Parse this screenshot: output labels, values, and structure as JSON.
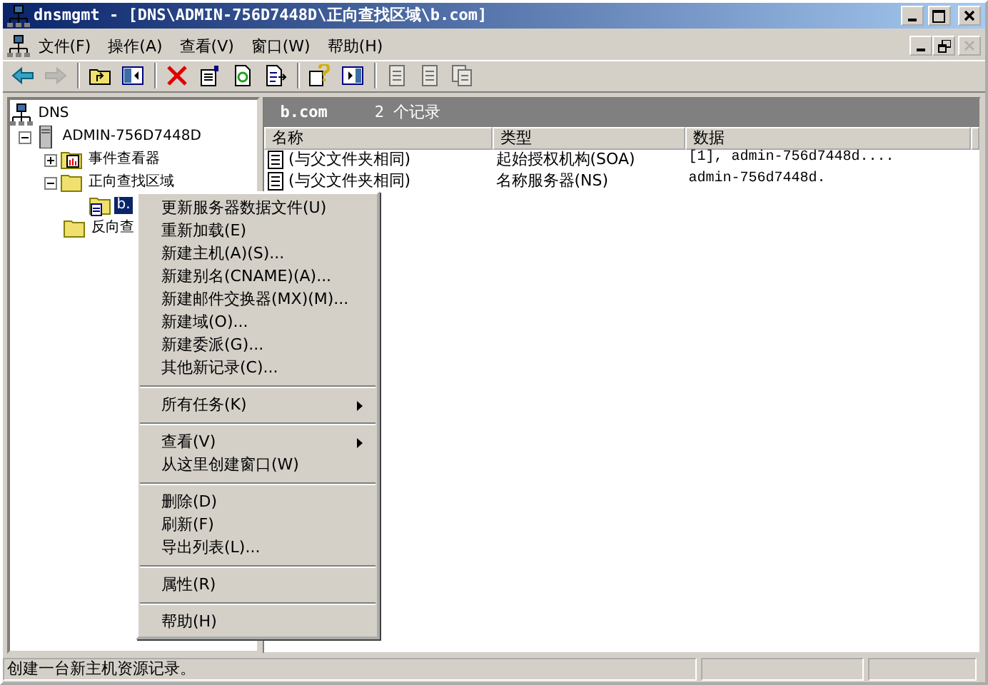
{
  "window": {
    "title": "dnsmgmt - [DNS\\ADMIN-756D7448D\\正向查找区域\\b.com]"
  },
  "menu_bar": [
    "文件(F)",
    "操作(A)",
    "查看(V)",
    "窗口(W)",
    "帮助(H)"
  ],
  "toolbar": [
    {
      "kind": "back",
      "disabled": false
    },
    {
      "kind": "forward",
      "disabled": true
    },
    {
      "kind": "separator"
    },
    {
      "kind": "up",
      "disabled": false
    },
    {
      "kind": "tree",
      "disabled": false
    },
    {
      "kind": "separator"
    },
    {
      "kind": "delete",
      "disabled": false
    },
    {
      "kind": "properties",
      "disabled": false
    },
    {
      "kind": "refresh",
      "disabled": false
    },
    {
      "kind": "export",
      "disabled": false
    },
    {
      "kind": "separator"
    },
    {
      "kind": "help",
      "disabled": false
    },
    {
      "kind": "panel",
      "disabled": false
    },
    {
      "kind": "separator"
    },
    {
      "kind": "doc",
      "disabled": true
    },
    {
      "kind": "doc",
      "disabled": true
    },
    {
      "kind": "docs",
      "disabled": true
    }
  ],
  "tree": [
    {
      "label": "DNS",
      "kind": "dns",
      "selected": false,
      "children": [
        {
          "label": "ADMIN-756D7448D",
          "kind": "server",
          "expanded": true,
          "selected": false,
          "children": [
            {
              "label": "事件查看器",
              "kind": "event",
              "expanded": false,
              "selected": false
            },
            {
              "label": "正向查找区域",
              "kind": "folder",
              "expanded": true,
              "selected": false,
              "children": [
                {
                  "label": "b.",
                  "kind": "zone",
                  "selected": true
                }
              ]
            },
            {
              "label": "反向查",
              "kind": "folder",
              "selected": false
            }
          ]
        }
      ]
    }
  ],
  "header": {
    "name": "b.com",
    "count": "2 个记录"
  },
  "columns": [
    "名称",
    "类型",
    "数据"
  ],
  "rows": [
    {
      "name": "(与父文件夹相同)",
      "type": "起始授权机构(SOA)",
      "data": "[1], admin-756d7448d...."
    },
    {
      "name": "(与父文件夹相同)",
      "type": "名称服务器(NS)",
      "data": "admin-756d7448d."
    }
  ],
  "context_menu": [
    {
      "kind": "item",
      "label": "更新服务器数据文件(U)",
      "submenu": false
    },
    {
      "kind": "item",
      "label": "重新加载(E)",
      "submenu": false
    },
    {
      "kind": "item",
      "label": "新建主机(A)(S)...",
      "submenu": false
    },
    {
      "kind": "item",
      "label": "新建别名(CNAME)(A)...",
      "submenu": false
    },
    {
      "kind": "item",
      "label": "新建邮件交换器(MX)(M)...",
      "submenu": false
    },
    {
      "kind": "item",
      "label": "新建域(O)...",
      "submenu": false
    },
    {
      "kind": "item",
      "label": "新建委派(G)...",
      "submenu": false
    },
    {
      "kind": "item",
      "label": "其他新记录(C)...",
      "submenu": false
    },
    {
      "kind": "separator"
    },
    {
      "kind": "item",
      "label": "所有任务(K)",
      "submenu": true
    },
    {
      "kind": "separator"
    },
    {
      "kind": "item",
      "label": "查看(V)",
      "submenu": true
    },
    {
      "kind": "item",
      "label": "从这里创建窗口(W)",
      "submenu": false
    },
    {
      "kind": "separator"
    },
    {
      "kind": "item",
      "label": "删除(D)",
      "submenu": false
    },
    {
      "kind": "item",
      "label": "刷新(F)",
      "submenu": false
    },
    {
      "kind": "item",
      "label": "导出列表(L)...",
      "submenu": false
    },
    {
      "kind": "separator"
    },
    {
      "kind": "item",
      "label": "属性(R)",
      "submenu": false
    },
    {
      "kind": "separator"
    },
    {
      "kind": "item",
      "label": "帮助(H)",
      "submenu": false
    }
  ],
  "status_bar": {
    "text": "创建一台新主机资源记录。"
  }
}
